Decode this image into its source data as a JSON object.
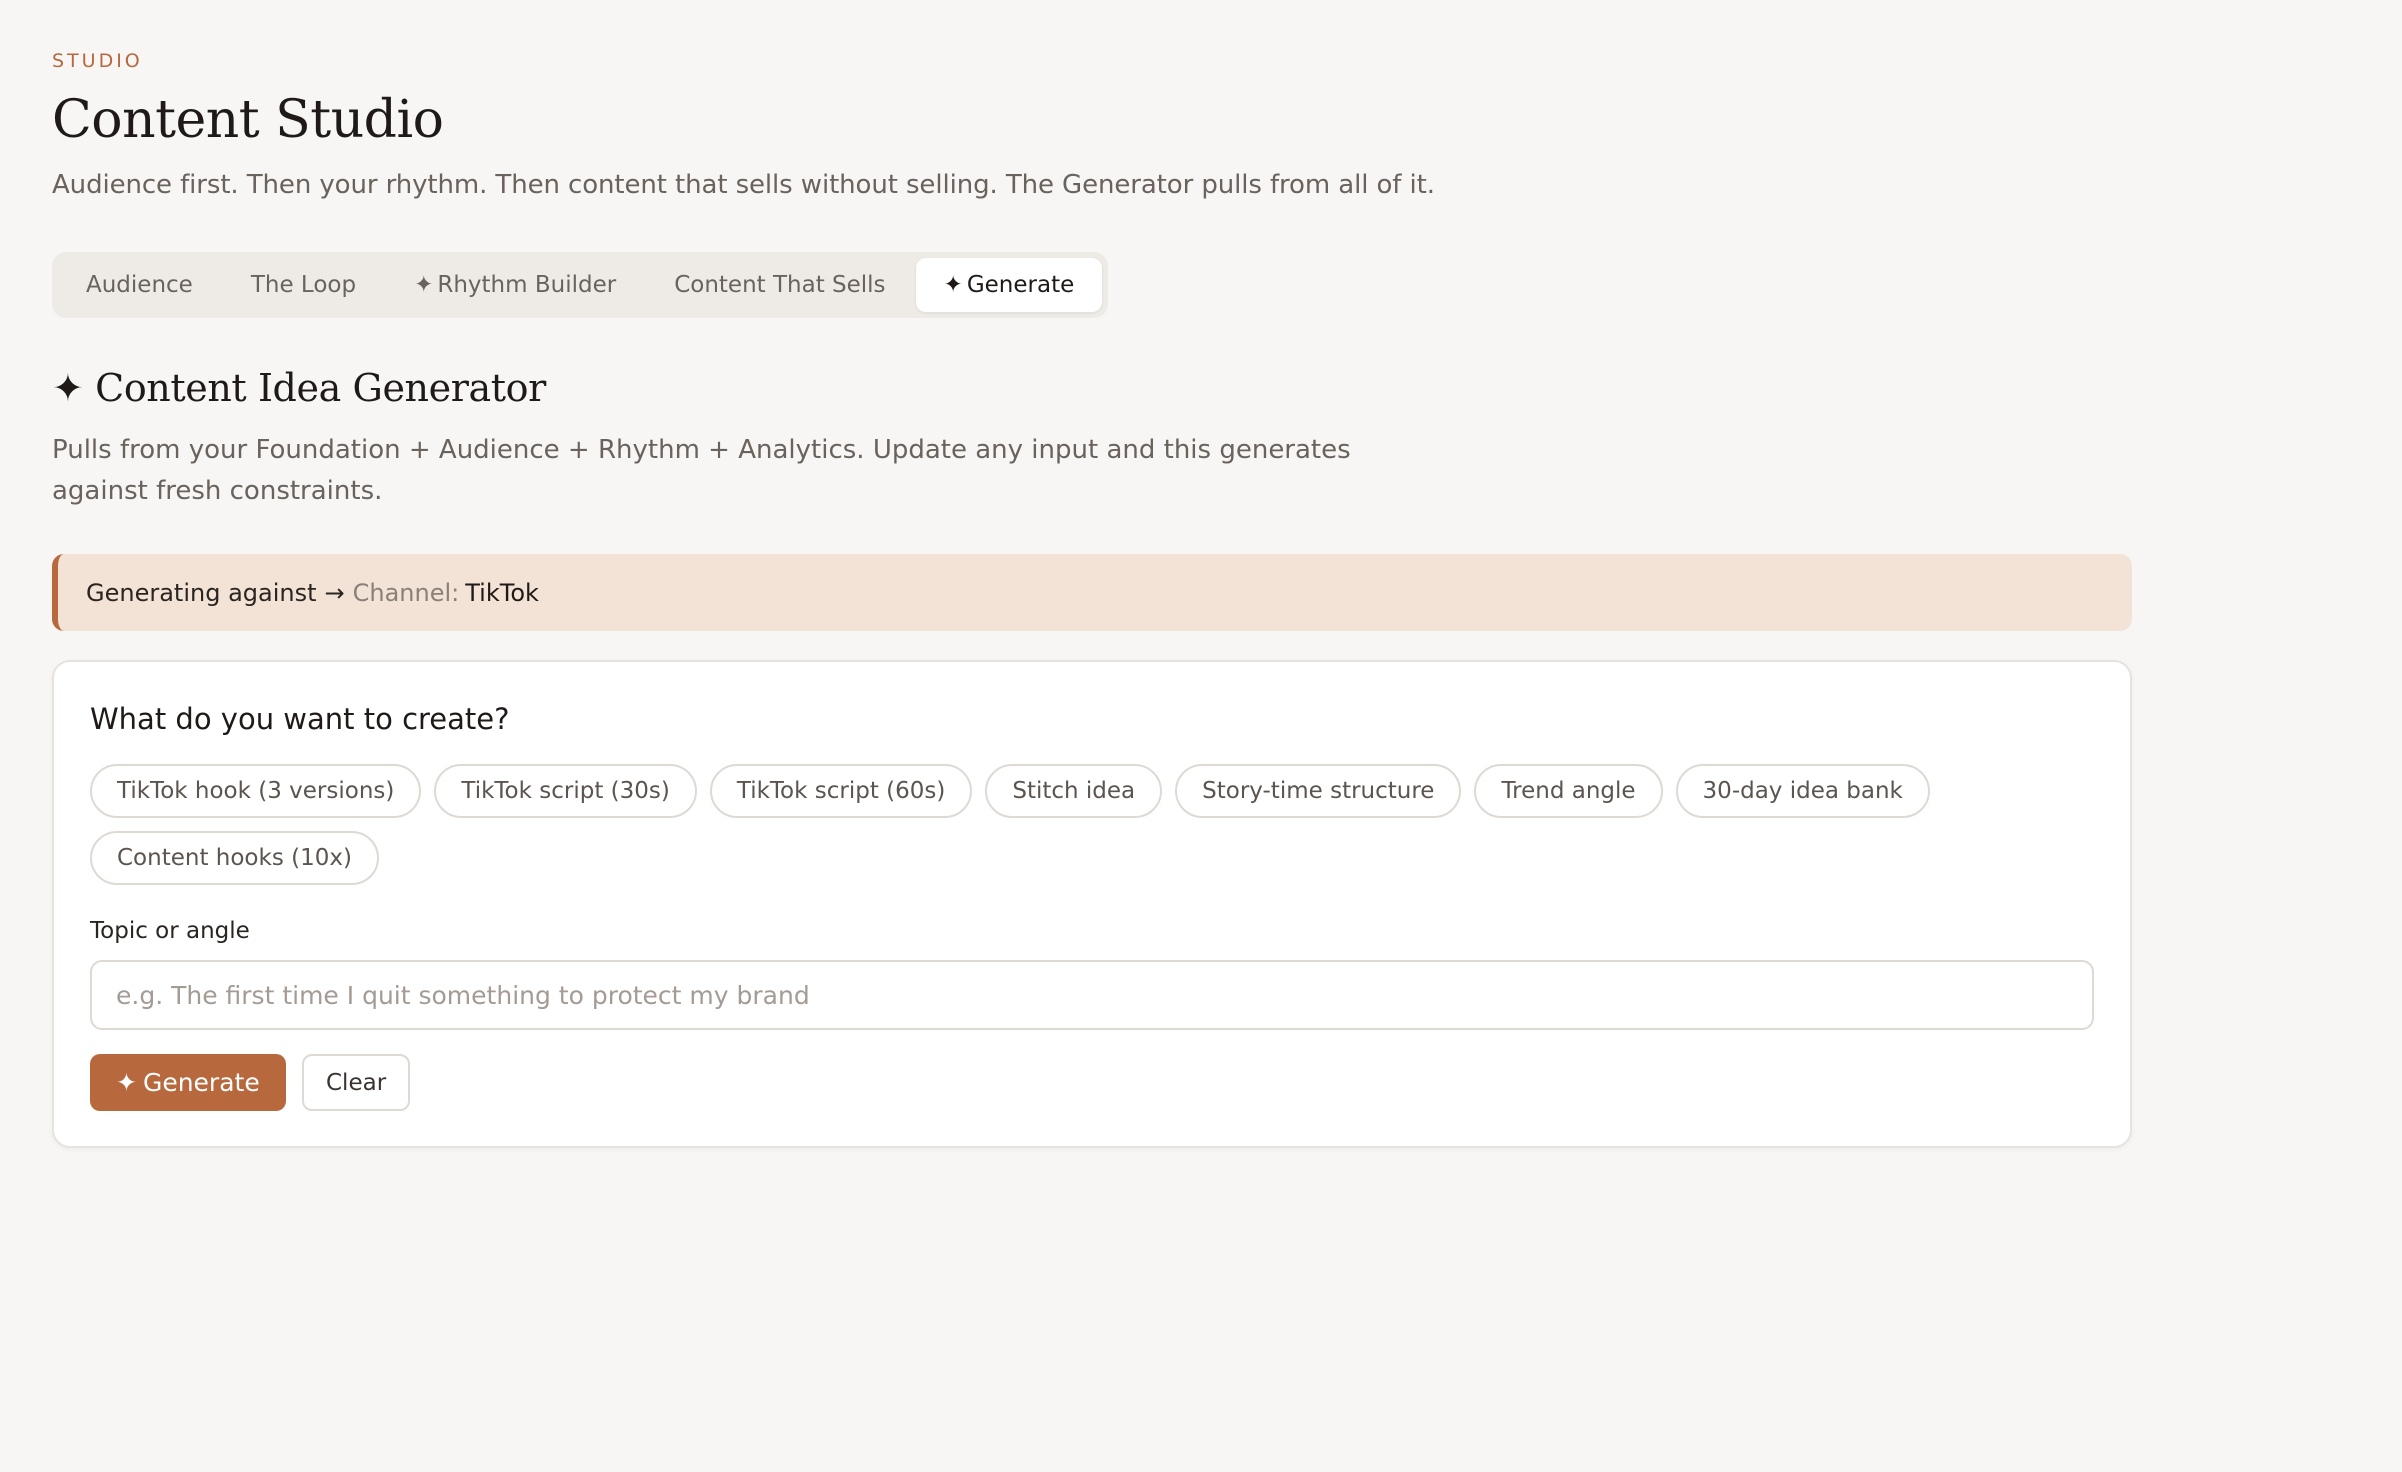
{
  "header": {
    "eyebrow": "STUDIO",
    "title": "Content Studio",
    "subtitle": "Audience first. Then your rhythm. Then content that sells without selling. The Generator pulls from all of it."
  },
  "tabs": [
    {
      "label": "Audience",
      "icon": "",
      "active": false
    },
    {
      "label": "The Loop",
      "icon": "",
      "active": false
    },
    {
      "label": "Rhythm Builder",
      "icon": "✦",
      "active": false
    },
    {
      "label": "Content That Sells",
      "icon": "",
      "active": false
    },
    {
      "label": "Generate",
      "icon": "✦",
      "active": true
    }
  ],
  "section": {
    "icon": "✦",
    "title": "Content Idea Generator",
    "description": "Pulls from your Foundation + Audience + Rhythm + Analytics. Update any input and this generates against fresh constraints."
  },
  "context": {
    "lead": "Generating against",
    "arrow": "→",
    "key": "Channel:",
    "value": "TikTok"
  },
  "form": {
    "question": "What do you want to create?",
    "chips_row1": [
      "TikTok hook (3 versions)",
      "TikTok script (30s)",
      "TikTok script (60s)",
      "Stitch idea",
      "Story-time structure",
      "Trend angle",
      "30-day idea bank"
    ],
    "chips_row2": [
      "Content hooks (10x)"
    ],
    "topic_label": "Topic or angle",
    "topic_value": "",
    "topic_placeholder": "e.g. The first time I quit something to protect my brand",
    "generate_icon": "✦",
    "generate_label": "Generate",
    "clear_label": "Clear"
  },
  "colors": {
    "accent": "#b8683d",
    "banner_bg": "#f2e3d6",
    "page_bg": "#f7f6f4"
  }
}
